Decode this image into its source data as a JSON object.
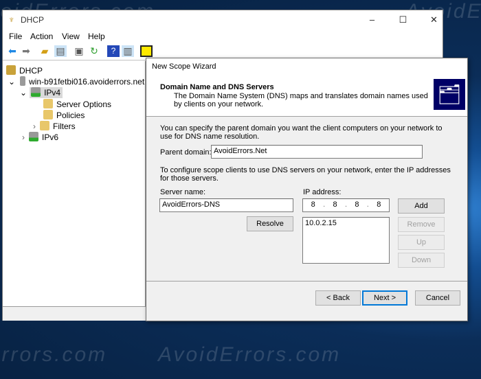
{
  "mmc": {
    "title": "DHCP",
    "menu": [
      "File",
      "Action",
      "View",
      "Help"
    ],
    "tree": {
      "root": "DHCP",
      "server": "win-b91fetbi016.avoiderrors.net",
      "ipv4": "IPv4",
      "server_options": "Server Options",
      "policies": "Policies",
      "filters": "Filters",
      "ipv6": "IPv6"
    }
  },
  "wizard": {
    "title": "New Scope Wizard",
    "heading": "Domain Name and DNS Servers",
    "subheading": "The Domain Name System (DNS) maps and translates domain names used by clients on your network.",
    "intro": "You can specify the parent domain you want the client computers on your network to use for DNS name resolution.",
    "parent_domain_label": "Parent domain:",
    "parent_domain_value": "AvoidErrors.Net",
    "dns_intro": "To configure scope clients to use DNS servers on your network, enter the IP addresses for those servers.",
    "server_name_label": "Server name:",
    "server_name_value": "AvoidErrors-DNS",
    "ip_label": "IP address:",
    "ip_octets": [
      "8",
      "8",
      "8",
      "8"
    ],
    "ip_list": [
      "10.0.2.15"
    ],
    "buttons": {
      "resolve": "Resolve",
      "add": "Add",
      "remove": "Remove",
      "up": "Up",
      "down": "Down",
      "back": "< Back",
      "next": "Next >",
      "cancel": "Cancel"
    }
  },
  "watermark": "AvoidErrors.com",
  "colors": {
    "accent": "#0078d7",
    "header_icon_bg": "#000066"
  }
}
